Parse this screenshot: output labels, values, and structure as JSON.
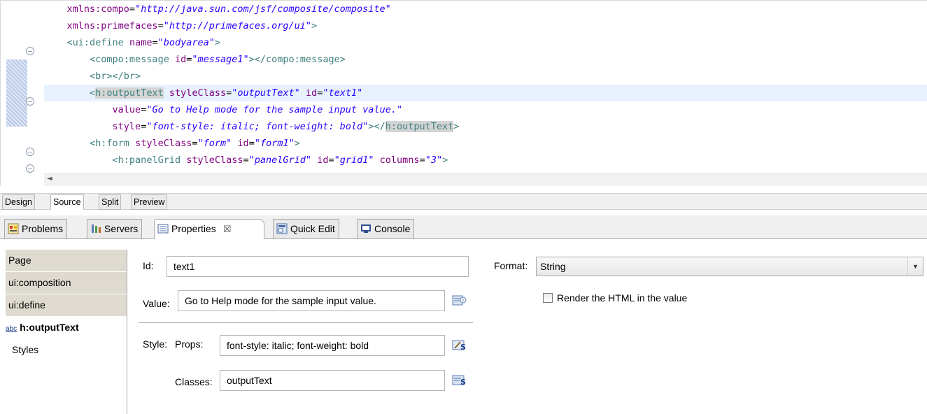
{
  "editor": {
    "lines": [
      {
        "indent": "    ",
        "parts": [
          [
            "attr",
            "xmlns:compo"
          ],
          [
            "punc",
            "="
          ],
          [
            "val",
            "\"http://java.sun.com/jsf/composite/composite\""
          ]
        ]
      },
      {
        "indent": "    ",
        "parts": [
          [
            "attr",
            "xmlns:primefaces"
          ],
          [
            "punc",
            "="
          ],
          [
            "val",
            "\"http://primefaces.org/ui\""
          ],
          [
            "tag",
            ">"
          ]
        ]
      },
      {
        "indent": "    ",
        "parts": [
          [
            "tag",
            "<ui:define"
          ],
          [
            "punc",
            " "
          ],
          [
            "attr",
            "name"
          ],
          [
            "punc",
            "="
          ],
          [
            "val",
            "\"bodyarea\""
          ],
          [
            "tag",
            ">"
          ]
        ]
      },
      {
        "indent": "        ",
        "parts": [
          [
            "tag",
            "<compo:message"
          ],
          [
            "punc",
            " "
          ],
          [
            "attr",
            "id"
          ],
          [
            "punc",
            "="
          ],
          [
            "val",
            "\"message1\""
          ],
          [
            "tag",
            "></compo:message>"
          ]
        ]
      },
      {
        "indent": "        ",
        "parts": [
          [
            "tag",
            "<br></br>"
          ]
        ]
      },
      {
        "indent": "        ",
        "parts": [
          [
            "tag",
            "<"
          ],
          [
            "taghl",
            "h:outputText"
          ],
          [
            "punc",
            " "
          ],
          [
            "attr",
            "styleClass"
          ],
          [
            "punc",
            "="
          ],
          [
            "val",
            "\"outputText\""
          ],
          [
            "punc",
            " "
          ],
          [
            "attr",
            "id"
          ],
          [
            "punc",
            "="
          ],
          [
            "val",
            "\"text1\""
          ]
        ]
      },
      {
        "indent": "            ",
        "parts": [
          [
            "attr",
            "value"
          ],
          [
            "punc",
            "="
          ],
          [
            "val",
            "\"Go to Help mode for the sample input value.\""
          ]
        ]
      },
      {
        "indent": "            ",
        "parts": [
          [
            "attr",
            "style"
          ],
          [
            "punc",
            "="
          ],
          [
            "val",
            "\"font-style: italic; font-weight: bold\""
          ],
          [
            "tag",
            "></"
          ],
          [
            "taghl",
            "h:outputText"
          ],
          [
            "tag",
            ">"
          ]
        ]
      },
      {
        "indent": "        ",
        "parts": [
          [
            "tag",
            "<h:form"
          ],
          [
            "punc",
            " "
          ],
          [
            "attr",
            "styleClass"
          ],
          [
            "punc",
            "="
          ],
          [
            "val",
            "\"form\""
          ],
          [
            "punc",
            " "
          ],
          [
            "attr",
            "id"
          ],
          [
            "punc",
            "="
          ],
          [
            "val",
            "\"form1\""
          ],
          [
            "tag",
            ">"
          ]
        ]
      },
      {
        "indent": "            ",
        "parts": [
          [
            "tag",
            "<h:panelGrid"
          ],
          [
            "punc",
            " "
          ],
          [
            "attr",
            "styleClass"
          ],
          [
            "punc",
            "="
          ],
          [
            "val",
            "\"panelGrid\""
          ],
          [
            "punc",
            " "
          ],
          [
            "attr",
            "id"
          ],
          [
            "punc",
            "="
          ],
          [
            "val",
            "\"grid1\""
          ],
          [
            "punc",
            " "
          ],
          [
            "attr",
            "columns"
          ],
          [
            "punc",
            "="
          ],
          [
            "val",
            "\"3\""
          ],
          [
            "tag",
            ">"
          ]
        ]
      }
    ],
    "scroll_left_glyph": "◄"
  },
  "page_tabs": [
    "Design",
    "Source",
    "Split",
    "Preview"
  ],
  "view_tabs": {
    "problems": "Problems",
    "servers": "Servers",
    "properties": "Properties",
    "properties_close": "☒",
    "quick_edit": "Quick Edit",
    "console": "Console"
  },
  "nav": {
    "page": "Page",
    "composition": "ui:composition",
    "define": "ui:define",
    "output_abc": "abc",
    "output_text": "h:outputText",
    "styles": "Styles"
  },
  "form": {
    "id_label": "Id:",
    "id_value": "text1",
    "value_label": "Value:",
    "value_value": "Go to Help mode for the sample input value.",
    "style_label": "Style:",
    "props_label": "Props:",
    "props_value": "font-style: italic; font-weight: bold",
    "classes_label": "Classes:",
    "classes_value": "outputText",
    "format_label": "Format:",
    "format_value": "String",
    "render_html_label": "Render the HTML in the value"
  },
  "icons": {
    "problems": "problems-icon",
    "servers": "servers-icon",
    "properties": "properties-icon",
    "quick_edit": "quick-edit-icon",
    "console": "console-icon",
    "value_binding": "binding-icon",
    "props_edit": "style-edit-icon",
    "classes_edit": "class-edit-icon"
  }
}
